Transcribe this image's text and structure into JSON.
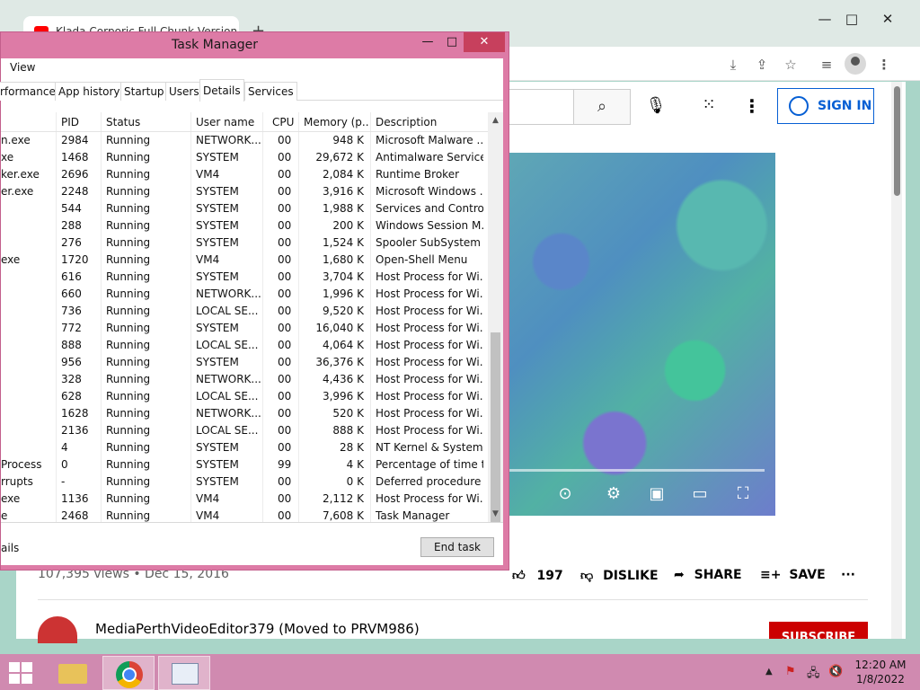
{
  "browser": {
    "tab_title": "Klada Corporic Full Chunk Version",
    "new_tab": "+",
    "minimize": "—",
    "maximize": "□",
    "close": "✕"
  },
  "youtube": {
    "sign_in": "SIGN IN",
    "views_date": "107,395 views • Dec 15, 2016",
    "like_count": "197",
    "dislike": "DISLIKE",
    "share": "SHARE",
    "save": "SAVE",
    "channel_name": "MediaPerthVideoEditor379 (Moved to PRVM986)",
    "subscribe": "SUBSCRIBE"
  },
  "task_manager": {
    "title": "Task Manager",
    "menu_view": "View",
    "minimize": "—",
    "maximize": "□",
    "close": "✕",
    "tabs": [
      "rformance",
      "App history",
      "Startup",
      "Users",
      "Details",
      "Services"
    ],
    "active_tab": "Details",
    "columns": [
      "PID",
      "Status",
      "User name",
      "CPU",
      "Memory (p...",
      "Description"
    ],
    "rows": [
      {
        "name": "n.exe",
        "pid": "2984",
        "status": "Running",
        "user": "NETWORK...",
        "cpu": "00",
        "mem": "948 K",
        "desc": "Microsoft Malware ..."
      },
      {
        "name": "xe",
        "pid": "1468",
        "status": "Running",
        "user": "SYSTEM",
        "cpu": "00",
        "mem": "29,672 K",
        "desc": "Antimalware Service..."
      },
      {
        "name": "ker.exe",
        "pid": "2696",
        "status": "Running",
        "user": "VM4",
        "cpu": "00",
        "mem": "2,084 K",
        "desc": "Runtime Broker"
      },
      {
        "name": "er.exe",
        "pid": "2248",
        "status": "Running",
        "user": "SYSTEM",
        "cpu": "00",
        "mem": "3,916 K",
        "desc": "Microsoft Windows ..."
      },
      {
        "name": "",
        "pid": "544",
        "status": "Running",
        "user": "SYSTEM",
        "cpu": "00",
        "mem": "1,988 K",
        "desc": "Services and Control..."
      },
      {
        "name": "",
        "pid": "288",
        "status": "Running",
        "user": "SYSTEM",
        "cpu": "00",
        "mem": "200 K",
        "desc": "Windows Session M..."
      },
      {
        "name": "",
        "pid": "276",
        "status": "Running",
        "user": "SYSTEM",
        "cpu": "00",
        "mem": "1,524 K",
        "desc": "Spooler SubSystem ..."
      },
      {
        "name": "exe",
        "pid": "1720",
        "status": "Running",
        "user": "VM4",
        "cpu": "00",
        "mem": "1,680 K",
        "desc": "Open-Shell Menu"
      },
      {
        "name": "",
        "pid": "616",
        "status": "Running",
        "user": "SYSTEM",
        "cpu": "00",
        "mem": "3,704 K",
        "desc": "Host Process for Wi..."
      },
      {
        "name": "",
        "pid": "660",
        "status": "Running",
        "user": "NETWORK...",
        "cpu": "00",
        "mem": "1,996 K",
        "desc": "Host Process for Wi..."
      },
      {
        "name": "",
        "pid": "736",
        "status": "Running",
        "user": "LOCAL SE...",
        "cpu": "00",
        "mem": "9,520 K",
        "desc": "Host Process for Wi..."
      },
      {
        "name": "",
        "pid": "772",
        "status": "Running",
        "user": "SYSTEM",
        "cpu": "00",
        "mem": "16,040 K",
        "desc": "Host Process for Wi..."
      },
      {
        "name": "",
        "pid": "888",
        "status": "Running",
        "user": "LOCAL SE...",
        "cpu": "00",
        "mem": "4,064 K",
        "desc": "Host Process for Wi..."
      },
      {
        "name": "",
        "pid": "956",
        "status": "Running",
        "user": "SYSTEM",
        "cpu": "00",
        "mem": "36,376 K",
        "desc": "Host Process for Wi..."
      },
      {
        "name": "",
        "pid": "328",
        "status": "Running",
        "user": "NETWORK...",
        "cpu": "00",
        "mem": "4,436 K",
        "desc": "Host Process for Wi..."
      },
      {
        "name": "",
        "pid": "628",
        "status": "Running",
        "user": "LOCAL SE...",
        "cpu": "00",
        "mem": "3,996 K",
        "desc": "Host Process for Wi..."
      },
      {
        "name": "",
        "pid": "1628",
        "status": "Running",
        "user": "NETWORK...",
        "cpu": "00",
        "mem": "520 K",
        "desc": "Host Process for Wi..."
      },
      {
        "name": "",
        "pid": "2136",
        "status": "Running",
        "user": "LOCAL SE...",
        "cpu": "00",
        "mem": "888 K",
        "desc": "Host Process for Wi..."
      },
      {
        "name": "",
        "pid": "4",
        "status": "Running",
        "user": "SYSTEM",
        "cpu": "00",
        "mem": "28 K",
        "desc": "NT Kernel & System"
      },
      {
        "name": "Process",
        "pid": "0",
        "status": "Running",
        "user": "SYSTEM",
        "cpu": "99",
        "mem": "4 K",
        "desc": "Percentage of time t..."
      },
      {
        "name": "rrupts",
        "pid": "-",
        "status": "Running",
        "user": "SYSTEM",
        "cpu": "00",
        "mem": "0 K",
        "desc": "Deferred procedure ..."
      },
      {
        "name": "exe",
        "pid": "1136",
        "status": "Running",
        "user": "VM4",
        "cpu": "00",
        "mem": "2,112 K",
        "desc": "Host Process for Wi..."
      },
      {
        "name": "e",
        "pid": "2468",
        "status": "Running",
        "user": "VM4",
        "cpu": "00",
        "mem": "7,608 K",
        "desc": "Task Manager"
      }
    ],
    "footer_details": "ails",
    "end_task": "End task"
  },
  "taskbar": {
    "time": "12:20 AM",
    "date": "1/8/2022"
  },
  "colors": {
    "task_manager_frame": "#dd7ba6",
    "taskbar": "#d08ab0",
    "youtube_blue": "#065fd4",
    "subscribe_red": "#cc0000"
  }
}
